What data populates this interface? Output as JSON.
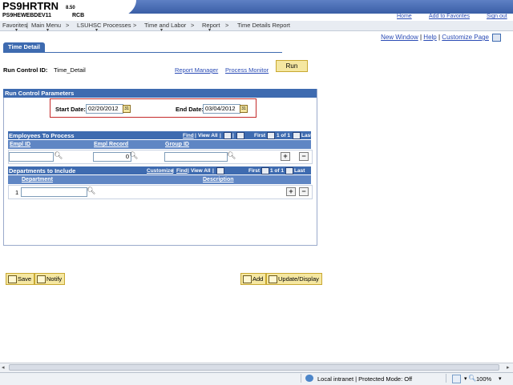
{
  "header": {
    "app_name": "PS9HRTRN",
    "version": "8.50",
    "database": "PS9HEWEBDEV11",
    "user": "RCB",
    "links": [
      "Home",
      "Add to Favorites",
      "Sign out"
    ]
  },
  "nav": {
    "items": [
      "Favorites",
      "Main Menu",
      "LSUHSC Processes",
      "Time and Labor",
      "Report",
      "Time Details Report"
    ]
  },
  "page_links": {
    "new_window": "New Window",
    "help": "Help",
    "customize_page": "Customize Page",
    "sep": "|"
  },
  "tab": {
    "label": "Time Detail"
  },
  "run_control": {
    "label": "Run Control ID:",
    "value": "Time_Detail",
    "report_manager": "Report Manager",
    "process_monitor": "Process Monitor",
    "run_button": "Run"
  },
  "params": {
    "title": "Run Control Parameters",
    "start_date_label": "Start Date:",
    "start_date": "02/20/2012",
    "end_date_label": "End Date:",
    "end_date": "03/04/2012"
  },
  "employees_grid": {
    "title": "Employees To Process",
    "nav_find": "Find",
    "nav_view_all": "View All",
    "nav_first": "First",
    "nav_range": "1 of 1",
    "nav_last": "Last",
    "columns": [
      "Empl ID",
      "Empl Record",
      "Group ID"
    ],
    "rows": [
      {
        "empl_id": "",
        "empl_record": "0",
        "group_id": ""
      }
    ]
  },
  "departments_grid": {
    "title": "Departments to Include",
    "nav_customize": "Customize",
    "nav_find": "Find",
    "nav_view_all": "View All",
    "nav_first": "First",
    "nav_range": "1 of 1",
    "nav_last": "Last",
    "columns": [
      "Department",
      "Description"
    ],
    "rows": [
      {
        "num": "1",
        "department": "",
        "description": ""
      }
    ]
  },
  "toolbar": {
    "save": "Save",
    "notify": "Notify",
    "add": "Add",
    "update_display": "Update/Display"
  },
  "statusbar": {
    "zone": "Local intranet | Protected Mode: Off",
    "zoom": "100%"
  },
  "colors": {
    "accent_blue": "#3e6bb0",
    "button_yellow": "#f5e7a1",
    "highlight_red": "#c42a2a"
  }
}
